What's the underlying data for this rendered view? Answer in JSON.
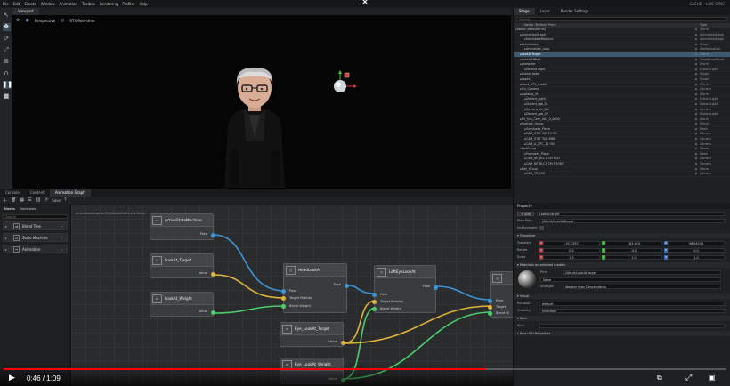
{
  "menu": {
    "items": [
      "File",
      "Edit",
      "Create",
      "Window",
      "Animation",
      "Toolbox",
      "Rendering",
      "Profiler",
      "Help"
    ],
    "right_items": [
      "CACHE",
      "LIVE SYNC"
    ]
  },
  "viewport": {
    "tab": "Viewport",
    "camera_label": "Perspective",
    "render_label": "RTX Real-time"
  },
  "bottom_tabs": [
    "Console",
    "Content",
    "Animation Graph"
  ],
  "graph_tools": {
    "save_label": "Save"
  },
  "nodes_panel": {
    "tabs": [
      "Nodes",
      "Variables"
    ],
    "search_placeholder": "Search",
    "items": [
      {
        "label": "Blend Tree",
        "icon": "blend-icon"
      },
      {
        "label": "State Machine",
        "icon": "state-machine-icon"
      },
      {
        "label": "Animation",
        "icon": "animation-icon"
      }
    ]
  },
  "graph": {
    "breadcrumb": "AnimationGraph ▸ MainStateMachine ▸ Activ...",
    "nodes": {
      "active_state_machine": {
        "title": "ActiveStateMachine",
        "out": "Pose"
      },
      "lookat_target": {
        "title": "LookAt_Target",
        "out": "Value"
      },
      "lookat_weight": {
        "title": "LookAt_Weight",
        "out": "Value"
      },
      "head_lookat": {
        "title": "HeadLookAt",
        "in1": "Pose",
        "in2": "Target Position",
        "in3": "Blend Weight",
        "out": "Pose"
      },
      "lefteye_lookat": {
        "title": "LeftEyeLookAt",
        "in1": "Pose",
        "in2": "Target Position",
        "in3": "Blend Weight",
        "out": "Pose"
      },
      "eye_lookat_target": {
        "title": "Eye_LookAt_Target",
        "out": "Value"
      },
      "eye_lookat_weight": {
        "title": "Eye_LookAt_Weight",
        "out": "Value"
      },
      "right_node": {
        "in1": "Pose",
        "in2": "Target",
        "in3": "Blend W"
      }
    }
  },
  "stage": {
    "tabs": [
      "Stage",
      "Layer",
      "Render Settings"
    ],
    "search_placeholder": "Search",
    "columns": [
      "Name (Default Prim)",
      "Type"
    ],
    "rows": [
      {
        "depth": 0,
        "name": "World (defaultPrim)",
        "type": "Xform"
      },
      {
        "depth": 1,
        "name": "AnimationGraph",
        "type": "AnimationGraph"
      },
      {
        "depth": 2,
        "name": "MainStateMachine",
        "type": "AnimationGraph"
      },
      {
        "depth": 1,
        "name": "Animations",
        "type": "Scope"
      },
      {
        "depth": 2,
        "name": "Animation_Loop",
        "type": "SkelAnimation"
      },
      {
        "depth": 1,
        "name": "LookAtTarget",
        "type": "Xform",
        "selected": true
      },
      {
        "depth": 1,
        "name": "LookAtOffset",
        "type": "OmniGraphNode"
      },
      {
        "depth": 1,
        "name": "character",
        "type": "Xform"
      },
      {
        "depth": 2,
        "name": "Default Light",
        "type": "DistantLight"
      },
      {
        "depth": 1,
        "name": "Scene_data",
        "type": "Scope"
      },
      {
        "depth": 1,
        "name": "Looks",
        "type": "Scope"
      },
      {
        "depth": 1,
        "name": "Sand_a71_model",
        "type": "Xform"
      },
      {
        "depth": 1,
        "name": "Viz_Camera",
        "type": "Camera"
      },
      {
        "depth": 1,
        "name": "Lighting_rlt",
        "type": "Xform"
      },
      {
        "depth": 2,
        "name": "Distant_Light",
        "type": "DistantLight"
      },
      {
        "depth": 2,
        "name": "Distant_rgb_01",
        "type": "DistantLight"
      },
      {
        "depth": 2,
        "name": "Camera_dir_lite",
        "type": "Camera"
      },
      {
        "depth": 2,
        "name": "Distant_rgb_02",
        "type": "DistantLight"
      },
      {
        "depth": 1,
        "name": "RV_Vcs_Cam_d07_0_0000",
        "type": "Xform"
      },
      {
        "depth": 1,
        "name": "Podcast_Group",
        "type": "Xform"
      },
      {
        "depth": 2,
        "name": "Sunshade_Plane",
        "type": "Mesh"
      },
      {
        "depth": 2,
        "name": "CAM_STAT WE 13 ON",
        "type": "Camera"
      },
      {
        "depth": 2,
        "name": "CAM_STAT TAG BRB",
        "type": "Camera"
      },
      {
        "depth": 2,
        "name": "CAM_A_CPC_11 ON",
        "type": "Camera"
      },
      {
        "depth": 1,
        "name": "PodGroup",
        "type": "Xform"
      },
      {
        "depth": 2,
        "name": "Prompter_Plane",
        "type": "Mesh"
      },
      {
        "depth": 2,
        "name": "CAM_NF_BLC1 CM RED",
        "type": "Camera"
      },
      {
        "depth": 2,
        "name": "CAM_NF_BLC1 CM FRONT",
        "type": "Camera"
      },
      {
        "depth": 1,
        "name": "Ball_Group",
        "type": "Xform"
      },
      {
        "depth": 2,
        "name": "CAM_TR_FAR",
        "type": "Camera"
      }
    ]
  },
  "property": {
    "title": "Property",
    "add_label": "Add",
    "name_value": "LookAtTarget",
    "prim_path_label": "Prim Path",
    "prim_path_value": "/World/LookAtTarget",
    "instanceable_label": "Instanceable",
    "transform_section": "Transform",
    "translate_label": "Translate",
    "rotate_label": "Rotate",
    "scale_label": "Scale",
    "translate": [
      "-92.2392",
      "163.474",
      "96.94106"
    ],
    "rotate": [
      "0.0",
      "-0.0",
      "0.0"
    ],
    "scale": [
      "1.0",
      "1.0",
      "1.0"
    ],
    "material_section": "Materials on selected models",
    "prim_label": "Prim",
    "prim_value": "/World/LookAtTarget",
    "material_value": "None",
    "strength_label": "Strength",
    "strength_value": "Weaker than Descendants",
    "visual_section": "Visual",
    "purpose_label": "Purpose",
    "purpose_value": "default",
    "visibility_label": "Visibility",
    "visibility_value": "inherited",
    "kind_section": "Kind",
    "kind_label": "Kind",
    "raw_section": "Raw USD Properties"
  },
  "player": {
    "time": "0:46 / 1:09",
    "progress": 0.667
  }
}
